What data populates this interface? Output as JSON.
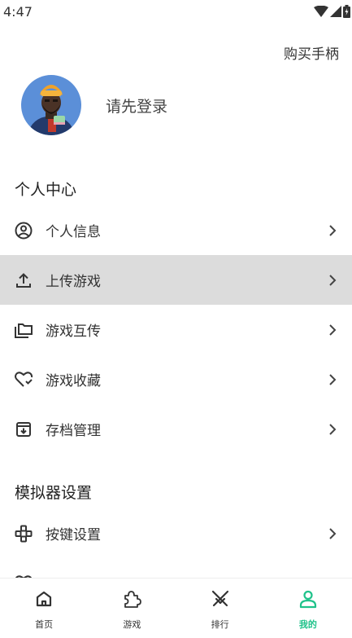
{
  "status_bar": {
    "time": "4:47"
  },
  "header": {
    "buy_controller": "购买手柄"
  },
  "profile": {
    "login_prompt": "请先登录"
  },
  "sections": {
    "personal_center": "个人中心",
    "emulator_settings": "模拟器设置"
  },
  "menu": {
    "personal_info": "个人信息",
    "upload_game": "上传游戏",
    "game_transfer": "游戏互传",
    "game_favorites": "游戏收藏",
    "save_management": "存档管理",
    "key_settings": "按键设置"
  },
  "tabs": [
    {
      "label": "首页",
      "icon": "home-icon"
    },
    {
      "label": "游戏",
      "icon": "puzzle-icon"
    },
    {
      "label": "排行",
      "icon": "crossed-swords-icon"
    },
    {
      "label": "我的",
      "icon": "person-icon"
    }
  ],
  "colors": {
    "accent": "#1fc28a",
    "active_row": "#dcdcdc"
  }
}
